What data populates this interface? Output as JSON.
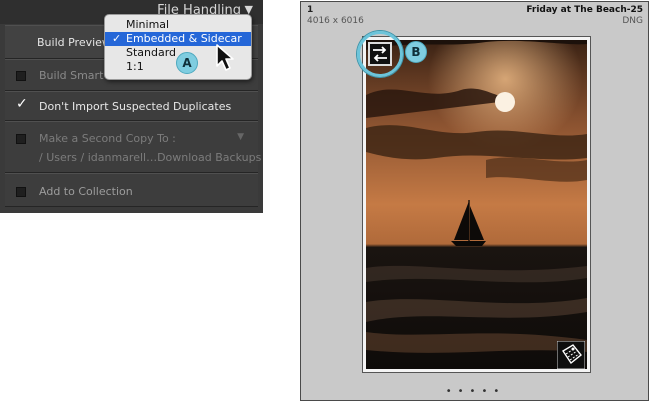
{
  "panel": {
    "title": "File Handling",
    "build_previews_label": "Build Preview",
    "smart_previews_label": "Build Smart P",
    "dont_import_label": "Don't Import Suspected Duplicates",
    "second_copy_label": "Make a Second Copy To :",
    "second_copy_path": "/ Users / idanmarell…Download Backups",
    "add_collection_label": "Add to Collection",
    "dont_import_checked": true
  },
  "dropdown": {
    "options": [
      "Minimal",
      "Embedded & Sidecar",
      "Standard",
      "1:1"
    ],
    "selected": "Embedded & Sidecar",
    "check_mark": "✓"
  },
  "callouts": {
    "a": "A",
    "b": "B"
  },
  "thumbnail": {
    "index": "1",
    "dimensions": "4016 x 6016",
    "filename": "Friday at The Beach-25",
    "format": "DNG",
    "dots": "•••••"
  },
  "icons": {
    "embedded_preview": "swap-arrows-icon",
    "corner_badge": "metadata-badge-icon",
    "panel_collapse": "triangle-down-icon",
    "cursor": "mouse-pointer-icon"
  },
  "colors": {
    "panel_bg": "#3a3a3a",
    "selection_blue": "#2567d8",
    "callout_cyan": "#7fcde0",
    "cell_bg": "#c9c9c9"
  }
}
